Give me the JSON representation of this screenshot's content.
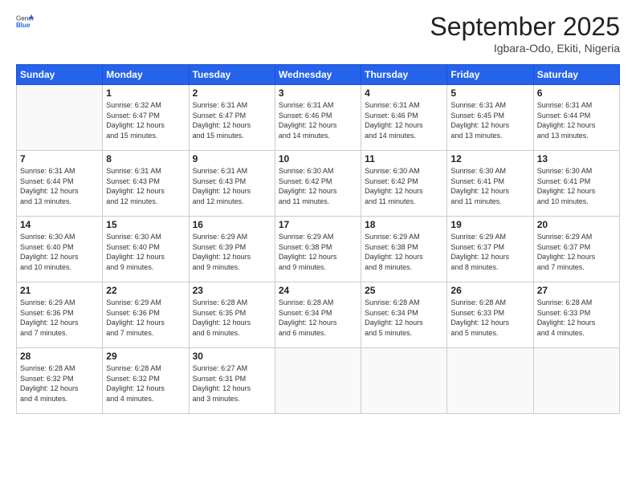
{
  "logo": {
    "general": "General",
    "blue": "Blue"
  },
  "header": {
    "month": "September 2025",
    "location": "Igbara-Odo, Ekiti, Nigeria"
  },
  "days_of_week": [
    "Sunday",
    "Monday",
    "Tuesday",
    "Wednesday",
    "Thursday",
    "Friday",
    "Saturday"
  ],
  "weeks": [
    [
      {
        "day": "",
        "info": ""
      },
      {
        "day": "1",
        "info": "Sunrise: 6:32 AM\nSunset: 6:47 PM\nDaylight: 12 hours\nand 15 minutes."
      },
      {
        "day": "2",
        "info": "Sunrise: 6:31 AM\nSunset: 6:47 PM\nDaylight: 12 hours\nand 15 minutes."
      },
      {
        "day": "3",
        "info": "Sunrise: 6:31 AM\nSunset: 6:46 PM\nDaylight: 12 hours\nand 14 minutes."
      },
      {
        "day": "4",
        "info": "Sunrise: 6:31 AM\nSunset: 6:46 PM\nDaylight: 12 hours\nand 14 minutes."
      },
      {
        "day": "5",
        "info": "Sunrise: 6:31 AM\nSunset: 6:45 PM\nDaylight: 12 hours\nand 13 minutes."
      },
      {
        "day": "6",
        "info": "Sunrise: 6:31 AM\nSunset: 6:44 PM\nDaylight: 12 hours\nand 13 minutes."
      }
    ],
    [
      {
        "day": "7",
        "info": "Sunrise: 6:31 AM\nSunset: 6:44 PM\nDaylight: 12 hours\nand 13 minutes."
      },
      {
        "day": "8",
        "info": "Sunrise: 6:31 AM\nSunset: 6:43 PM\nDaylight: 12 hours\nand 12 minutes."
      },
      {
        "day": "9",
        "info": "Sunrise: 6:31 AM\nSunset: 6:43 PM\nDaylight: 12 hours\nand 12 minutes."
      },
      {
        "day": "10",
        "info": "Sunrise: 6:30 AM\nSunset: 6:42 PM\nDaylight: 12 hours\nand 11 minutes."
      },
      {
        "day": "11",
        "info": "Sunrise: 6:30 AM\nSunset: 6:42 PM\nDaylight: 12 hours\nand 11 minutes."
      },
      {
        "day": "12",
        "info": "Sunrise: 6:30 AM\nSunset: 6:41 PM\nDaylight: 12 hours\nand 11 minutes."
      },
      {
        "day": "13",
        "info": "Sunrise: 6:30 AM\nSunset: 6:41 PM\nDaylight: 12 hours\nand 10 minutes."
      }
    ],
    [
      {
        "day": "14",
        "info": "Sunrise: 6:30 AM\nSunset: 6:40 PM\nDaylight: 12 hours\nand 10 minutes."
      },
      {
        "day": "15",
        "info": "Sunrise: 6:30 AM\nSunset: 6:40 PM\nDaylight: 12 hours\nand 9 minutes."
      },
      {
        "day": "16",
        "info": "Sunrise: 6:29 AM\nSunset: 6:39 PM\nDaylight: 12 hours\nand 9 minutes."
      },
      {
        "day": "17",
        "info": "Sunrise: 6:29 AM\nSunset: 6:38 PM\nDaylight: 12 hours\nand 9 minutes."
      },
      {
        "day": "18",
        "info": "Sunrise: 6:29 AM\nSunset: 6:38 PM\nDaylight: 12 hours\nand 8 minutes."
      },
      {
        "day": "19",
        "info": "Sunrise: 6:29 AM\nSunset: 6:37 PM\nDaylight: 12 hours\nand 8 minutes."
      },
      {
        "day": "20",
        "info": "Sunrise: 6:29 AM\nSunset: 6:37 PM\nDaylight: 12 hours\nand 7 minutes."
      }
    ],
    [
      {
        "day": "21",
        "info": "Sunrise: 6:29 AM\nSunset: 6:36 PM\nDaylight: 12 hours\nand 7 minutes."
      },
      {
        "day": "22",
        "info": "Sunrise: 6:29 AM\nSunset: 6:36 PM\nDaylight: 12 hours\nand 7 minutes."
      },
      {
        "day": "23",
        "info": "Sunrise: 6:28 AM\nSunset: 6:35 PM\nDaylight: 12 hours\nand 6 minutes."
      },
      {
        "day": "24",
        "info": "Sunrise: 6:28 AM\nSunset: 6:34 PM\nDaylight: 12 hours\nand 6 minutes."
      },
      {
        "day": "25",
        "info": "Sunrise: 6:28 AM\nSunset: 6:34 PM\nDaylight: 12 hours\nand 5 minutes."
      },
      {
        "day": "26",
        "info": "Sunrise: 6:28 AM\nSunset: 6:33 PM\nDaylight: 12 hours\nand 5 minutes."
      },
      {
        "day": "27",
        "info": "Sunrise: 6:28 AM\nSunset: 6:33 PM\nDaylight: 12 hours\nand 4 minutes."
      }
    ],
    [
      {
        "day": "28",
        "info": "Sunrise: 6:28 AM\nSunset: 6:32 PM\nDaylight: 12 hours\nand 4 minutes."
      },
      {
        "day": "29",
        "info": "Sunrise: 6:28 AM\nSunset: 6:32 PM\nDaylight: 12 hours\nand 4 minutes."
      },
      {
        "day": "30",
        "info": "Sunrise: 6:27 AM\nSunset: 6:31 PM\nDaylight: 12 hours\nand 3 minutes."
      },
      {
        "day": "",
        "info": ""
      },
      {
        "day": "",
        "info": ""
      },
      {
        "day": "",
        "info": ""
      },
      {
        "day": "",
        "info": ""
      }
    ]
  ]
}
